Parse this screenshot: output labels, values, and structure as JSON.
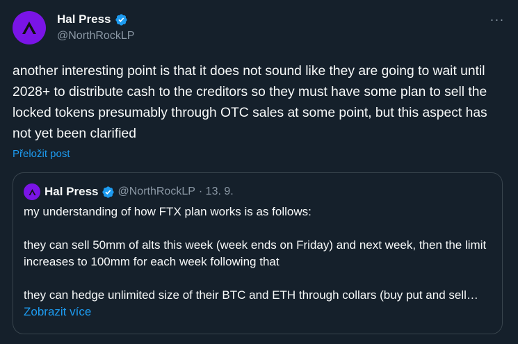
{
  "tweet": {
    "author": {
      "display_name": "Hal Press",
      "handle": "@NorthRockLP",
      "verified": true,
      "avatar_icon": "northrock-logo-icon"
    },
    "more_icon": "more-horizontal-icon",
    "more_label": "···",
    "text": "another interesting point is that it does not sound like they are going to wait until 2028+ to distribute cash to the creditors so they must have some plan to sell the locked tokens presumably through OTC sales at some point, but this aspect has not yet been clarified",
    "translate_label": "Přeložit post"
  },
  "quoted_tweet": {
    "author": {
      "display_name": "Hal Press",
      "handle": "@NorthRockLP",
      "verified": true
    },
    "date": "· 13. 9.",
    "paragraphs": [
      "my understanding of how FTX plan works is as follows:",
      "they can sell 50mm of alts this week (week ends on Friday) and next week, then the limit increases to 100mm for each week following that",
      "they can hedge unlimited size of their BTC and ETH through collars (buy put and sell…"
    ],
    "show_more_label": "Zobrazit více"
  },
  "colors": {
    "background": "#15202b",
    "accent": "#1d9bf0",
    "secondary_text": "#8b98a5",
    "avatar": "#7a14e6"
  }
}
